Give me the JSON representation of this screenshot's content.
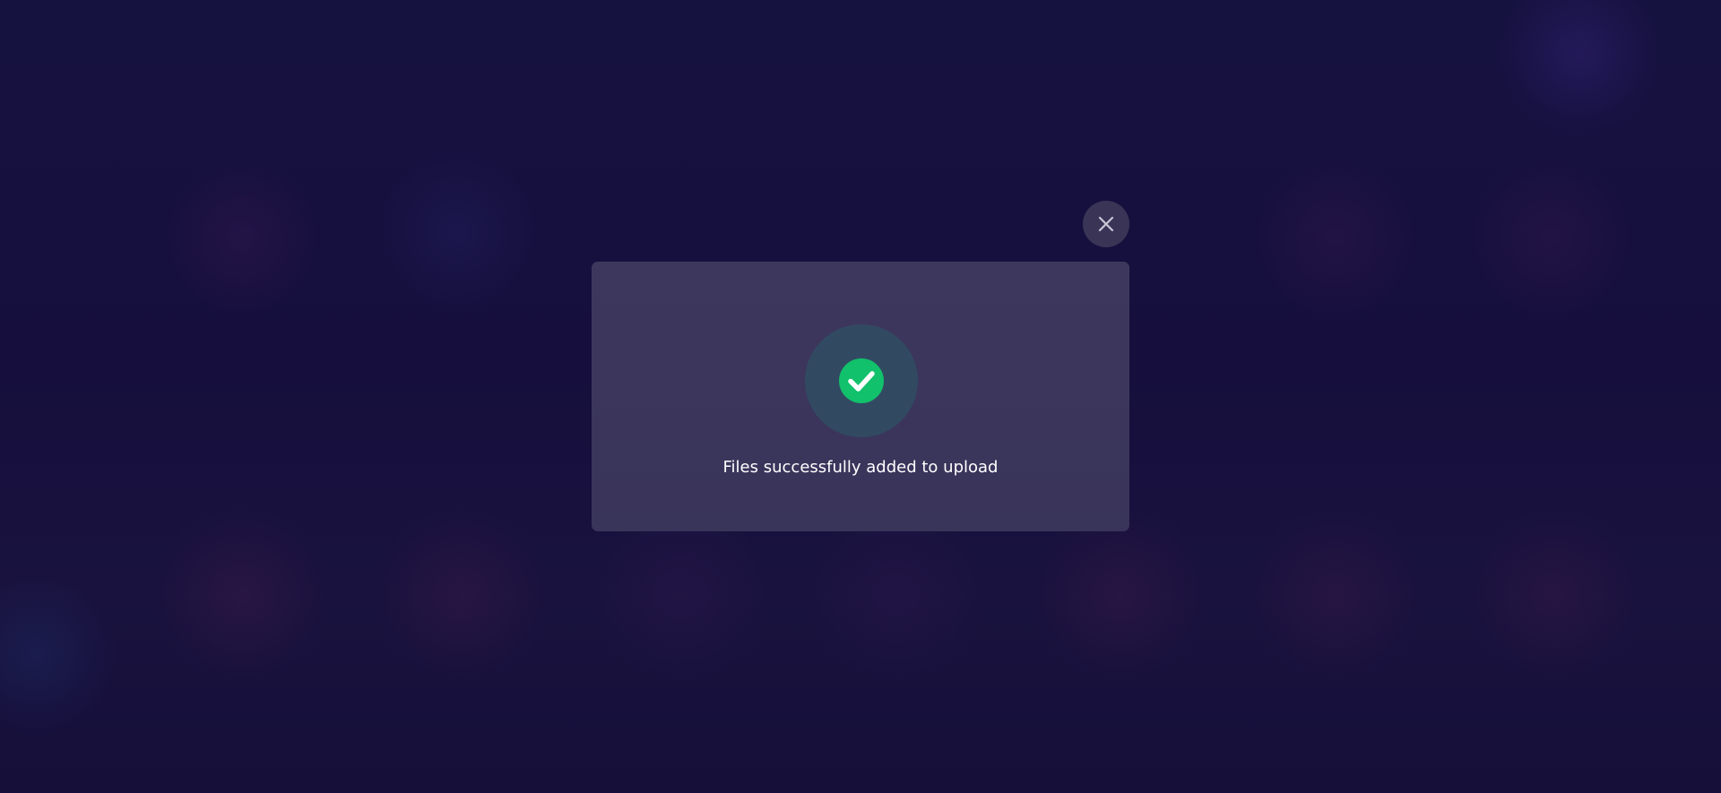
{
  "modal": {
    "message": "Files successfully added to upload",
    "icon": "check-circle-icon",
    "close_icon": "close-icon"
  },
  "colors": {
    "background": "#16123d",
    "modal_background": "#3c365c",
    "close_button_background": "#3a3457",
    "success_ring": "#314a62",
    "success_green": "#12c16b",
    "text": "#ffffff"
  }
}
